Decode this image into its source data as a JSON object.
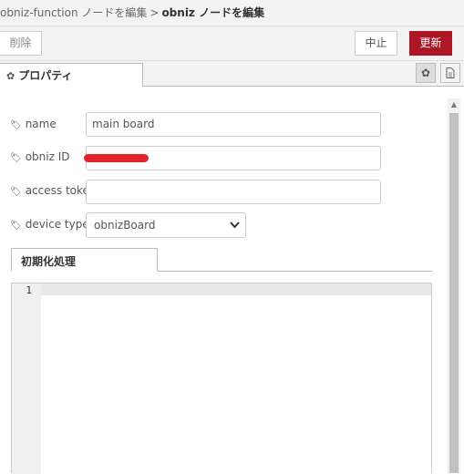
{
  "breadcrumb": {
    "parent": "obniz-function ノードを編集",
    "separator": ">",
    "current": "obniz ノードを編集"
  },
  "toolbar": {
    "delete_label": "削除",
    "cancel_label": "中止",
    "update_label": "更新"
  },
  "tabs": {
    "properties_label": "プロパティ",
    "properties_icon": "gear-icon",
    "settings_icon": "gear-icon",
    "description_icon": "document-icon"
  },
  "form": {
    "name": {
      "label": "name",
      "value": "main board",
      "icon": "tag-icon"
    },
    "obniz_id": {
      "label": "obniz ID",
      "value": "",
      "icon": "tag-icon"
    },
    "access_token": {
      "label": "access token",
      "value": "",
      "icon": "tag-icon"
    },
    "device_type": {
      "label": "device type",
      "value": "obnizBoard",
      "icon": "tag-icon"
    }
  },
  "editor": {
    "tab_label": "初期化処理",
    "line_numbers": [
      "1"
    ]
  },
  "colors": {
    "update_button": "#ad1625",
    "redaction": "#e4222a"
  }
}
